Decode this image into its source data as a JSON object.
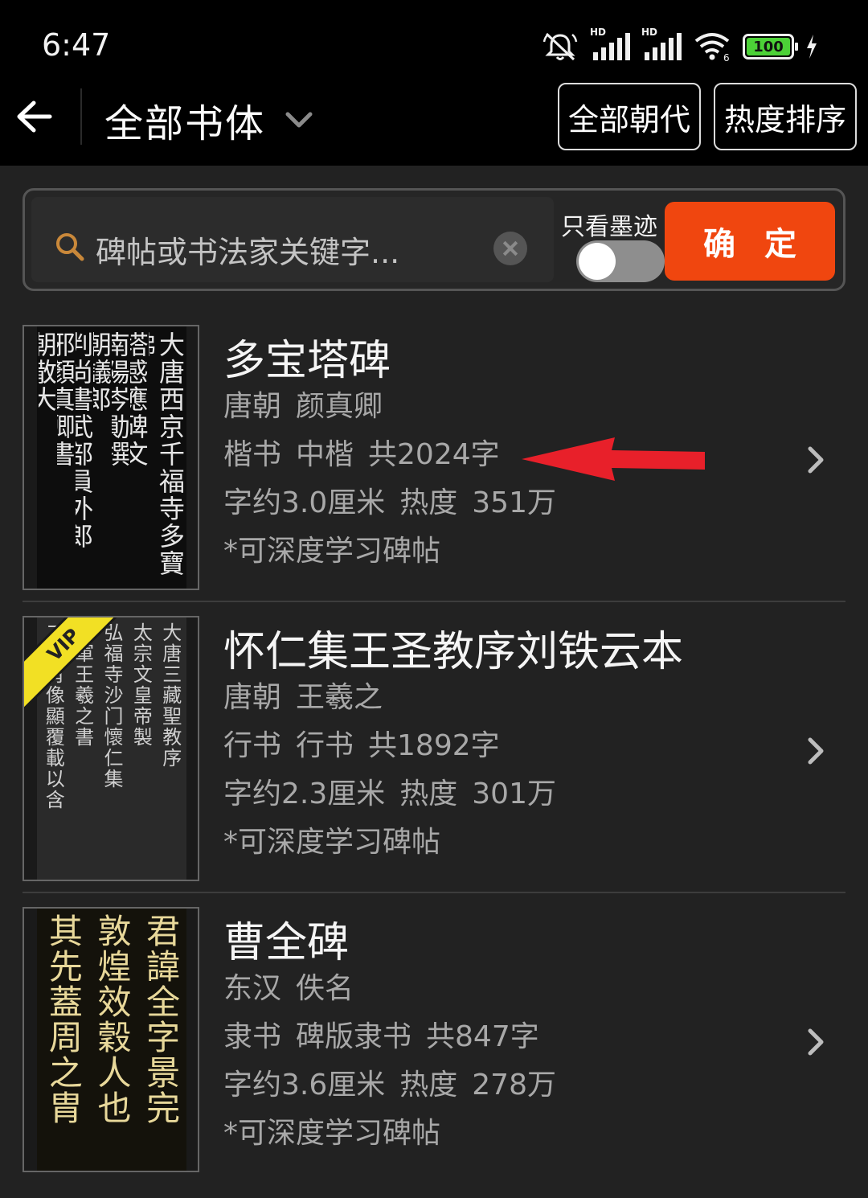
{
  "status": {
    "time": "6:47",
    "battery": "100",
    "hd": "HD"
  },
  "header": {
    "title": "全部书体",
    "era_button": "全部朝代",
    "sort_button": "热度排序"
  },
  "search": {
    "placeholder": "碑帖或书法家关键字...",
    "ink_only_label": "只看墨迹",
    "ink_only_on": false,
    "confirm_label": "确定"
  },
  "items": [
    {
      "name": "多宝塔碑",
      "era": "唐朝",
      "author": "颜真卿",
      "script": "楷书",
      "style": "中楷",
      "count": "共2024字",
      "size": "字约3.0厘米",
      "heat_label": "热度",
      "heat": "351万",
      "note": "*可深度学习碑帖",
      "vip": false,
      "thumb_columns": [
        "大唐西京千福寺多寶佛",
        "塔感應碑文",
        "南陽岑勛撰",
        "判尚書武部員外郎",
        "邪顏真卿書",
        "朝議郎",
        "朝散大",
        "瑯"
      ]
    },
    {
      "name": "怀仁集王圣教序刘铁云本",
      "era": "唐朝",
      "author": "王羲之",
      "script": "行书",
      "style": "行书",
      "count": "共1892字",
      "size": "字约2.3厘米",
      "heat_label": "热度",
      "heat": "301万",
      "note": "*可深度学习碑帖",
      "vip": true,
      "vip_label": "VIP",
      "thumb_columns": [
        "大唐三藏聖教序",
        "太宗文皇帝製",
        "弘福寺沙门懷仁集",
        "將軍王羲之書",
        "二儀有像顯覆載以含"
      ]
    },
    {
      "name": "曹全碑",
      "era": "东汉",
      "author": "佚名",
      "script": "隶书",
      "style": "碑版隶书",
      "count": "共847字",
      "size": "字约3.6厘米",
      "heat_label": "热度",
      "heat": "278万",
      "note": "*可深度学习碑帖",
      "vip": false,
      "thumb_columns": [
        "君諱全字景完",
        "敦煌效穀人也",
        "其先蓋周之胄"
      ]
    }
  ],
  "annotation": {
    "arrow_color": "#e8202a"
  }
}
